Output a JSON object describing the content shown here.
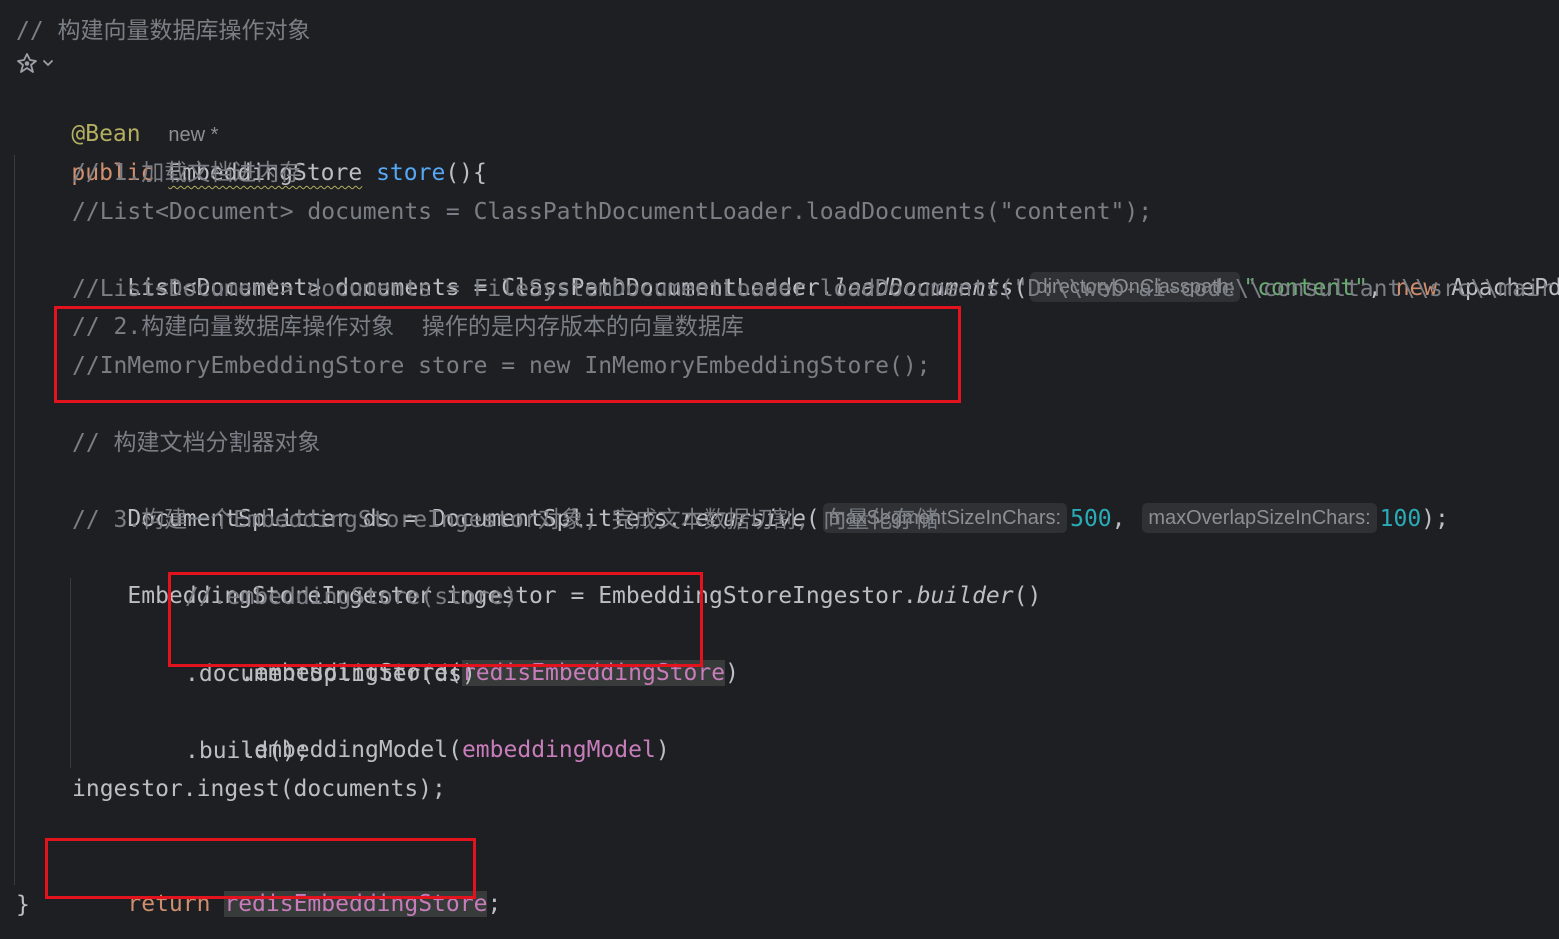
{
  "header": {
    "comment": "// 构建向量数据库操作对象",
    "annotation": "@Bean",
    "usages": "new *"
  },
  "signature": {
    "modifier": "public",
    "return_type": "EmbeddingStore",
    "method_name": "store",
    "params": "(){"
  },
  "lines": {
    "c1": "// 1.加载文档进内存",
    "c2": "//List<Document> documents = ClassPathDocumentLoader.loadDocuments(\"content\");",
    "l3_a": "List<Document> documents = ClassPathDocumentLoader.",
    "l3_method": "loadDocuments",
    "l3_paren": "(",
    "l3_hint": "directoryOnClasspath:",
    "l3_str": "\"content\"",
    "l3_comma": ", ",
    "l3_new": "new",
    "l3_rest": " ApachePdf",
    "c4": "//List<Document> documents = FileSystemDocumentLoader.loadDocuments(\"D:\\\\web-ai-code\\\\consultant\\\\src\\\\mair",
    "c5": "// 2.构建向量数据库操作对象  操作的是内存版本的向量数据库",
    "c6": "//InMemoryEmbeddingStore store = new InMemoryEmbeddingStore();",
    "c7": "// 构建文档分割器对象",
    "l8_a": "DocumentSplitter ds = DocumentSplitters.",
    "l8_method": "recursive",
    "l8_paren": "(",
    "l8_hint1": "maxSegmentSizeInChars:",
    "l8_num1": "500",
    "l8_comma": ", ",
    "l8_hint2": "maxOverlapSizeInChars:",
    "l8_num2": "100",
    "l8_end": ");",
    "c9": "// 3.构建一个EmbeddingStoreIngestor对象, 完成文本数据切割, 向量化存储",
    "l10_a": "EmbeddingStoreIngestor ingestor = EmbeddingStoreIngestor.",
    "l10_method": "builder",
    "l10_end": "()",
    "c11": "//.embeddingStore(store)",
    "l12_a": ".embeddingStore(",
    "l12_field": "redisEmbeddingStore",
    "l12_end": ")",
    "l13": ".documentSplitter(ds)",
    "l14_a": ".embeddingModel(",
    "l14_field": "embeddingModel",
    "l14_end": ")",
    "l15": ".build();",
    "l16": "ingestor.ingest(documents);",
    "l18_kw": "return",
    "l18_field": "redisEmbeddingStore",
    "l18_end": ";",
    "l19": "}"
  },
  "icons": {
    "ai_assistant": "ai-assistant-icon",
    "dropdown": "chevron-down-icon"
  },
  "colors": {
    "background": "#1e1f22",
    "text": "#bcbec4",
    "comment": "#7a7e85",
    "keyword": "#cf8e6d",
    "annotation": "#b3ae60",
    "method": "#56a8f5",
    "string": "#6aab73",
    "number": "#2aacb8",
    "field": "#c77dbb",
    "highlight_box": "#e3131e"
  }
}
